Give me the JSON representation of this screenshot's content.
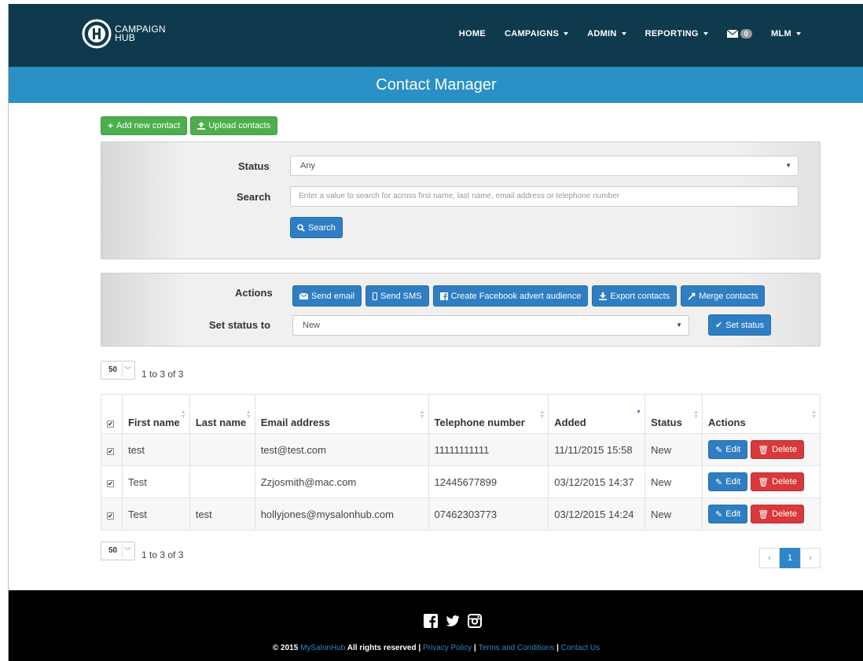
{
  "nav": {
    "logo_line1": "CAMPAIGN",
    "logo_line2": "HUB",
    "items": [
      {
        "label": "HOME",
        "dropdown": false
      },
      {
        "label": "CAMPAIGNS",
        "dropdown": true
      },
      {
        "label": "ADMIN",
        "dropdown": true
      },
      {
        "label": "REPORTING",
        "dropdown": true
      }
    ],
    "mail_count": "0",
    "user_label": "MLM"
  },
  "page_title": "Contact Manager",
  "toolbar": {
    "add_label": "Add new contact",
    "upload_label": "Upload contacts"
  },
  "filters": {
    "status_label": "Status",
    "status_value": "Any",
    "search_label": "Search",
    "search_placeholder": "Enter a value to search for across first name, last name, email address or telephone number",
    "search_button": "Search"
  },
  "actions": {
    "label": "Actions",
    "send_email": "Send email",
    "send_sms": "Send SMS",
    "facebook": "Create Facebook advert audience",
    "export": "Export contacts",
    "merge": "Merge contacts",
    "set_status_label": "Set status to",
    "set_status_value": "New",
    "set_status_button": "Set status"
  },
  "pager": {
    "page_size": "50",
    "range": "1 to 3 of 3",
    "current_page": "1"
  },
  "table": {
    "columns": {
      "first": "First name",
      "last": "Last name",
      "email": "Email address",
      "phone": "Telephone number",
      "added": "Added",
      "status": "Status",
      "actions": "Actions"
    },
    "edit_label": "Edit",
    "delete_label": "Delete",
    "rows": [
      {
        "first": "test",
        "last": "",
        "email": "test@test.com",
        "phone": "11111111111",
        "added": "11/11/2015 15:58",
        "status": "New"
      },
      {
        "first": "Test",
        "last": "",
        "email": "Zzjosmith@mac.com",
        "phone": "12445677899",
        "added": "03/12/2015 14:37",
        "status": "New"
      },
      {
        "first": "Test",
        "last": "test",
        "email": "hollyjones@mysalonhub.com",
        "phone": "07462303773",
        "added": "03/12/2015 14:24",
        "status": "New"
      }
    ]
  },
  "footer": {
    "copyright": "© 2015",
    "brand": "MySalonHub",
    "rights": "All rights reserved",
    "privacy": "Privacy Policy",
    "terms": "Terms and Conditions",
    "contact": "Contact Us",
    "separator": "|"
  },
  "colors": {
    "nav_bg": "#0f3a4d",
    "band_bg": "#2890c4",
    "primary": "#2f7ec3",
    "success": "#4cae4c",
    "danger": "#d9393b"
  }
}
